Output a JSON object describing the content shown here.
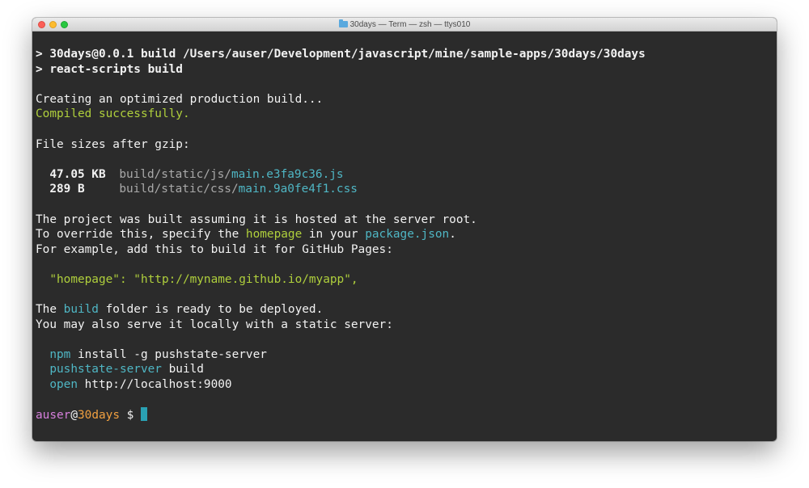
{
  "window": {
    "title": "30days — Term — zsh — ttys010"
  },
  "terminal": {
    "cmd_line_1": "> 30days@0.0.1 build /Users/auser/Development/javascript/mine/sample-apps/30days/30days",
    "cmd_line_2": "> react-scripts build",
    "creating": "Creating an optimized production build...",
    "compiled": "Compiled successfully.",
    "file_sizes_heading": "File sizes after gzip:",
    "files": [
      {
        "size": "47.05 KB",
        "dir": "build/static/js/",
        "name": "main.e3fa9c36.js"
      },
      {
        "size": "289 B",
        "dir": "build/static/css/",
        "name": "main.9a0fe4f1.css"
      }
    ],
    "hosted_line": "The project was built assuming it is hosted at the server root.",
    "override": {
      "prefix": "To override this, specify the ",
      "homepage": "homepage",
      "middle": " in your ",
      "package_json": "package.json",
      "suffix": "."
    },
    "example_line": "For example, add this to build it for GitHub Pages:",
    "homepage_json": {
      "key": "\"homepage\"",
      "sep": ": ",
      "value": "\"http://myname.github.io/myapp\"",
      "comma": ","
    },
    "deploy": {
      "prefix": "The ",
      "build": "build",
      "suffix": " folder is ready to be deployed."
    },
    "serve_line": "You may also serve it locally with a static server:",
    "cmds": [
      {
        "cmd": "npm",
        "args": " install -g pushstate-server"
      },
      {
        "cmd": "pushstate-server",
        "args": " build"
      },
      {
        "cmd": "open",
        "args": " http://localhost:9000"
      }
    ],
    "prompt": {
      "user": "auser",
      "at": "@",
      "host": "30days",
      "symbol": " $ "
    }
  },
  "colors": {
    "background": "#2b2b2b",
    "text": "#f2f2f2",
    "green": "#afcf3c",
    "cyan": "#4fb6c4",
    "gray": "#a9a9a9",
    "magenta": "#d67fdc",
    "orange": "#f0a040",
    "cursor": "#2aa1b3"
  }
}
